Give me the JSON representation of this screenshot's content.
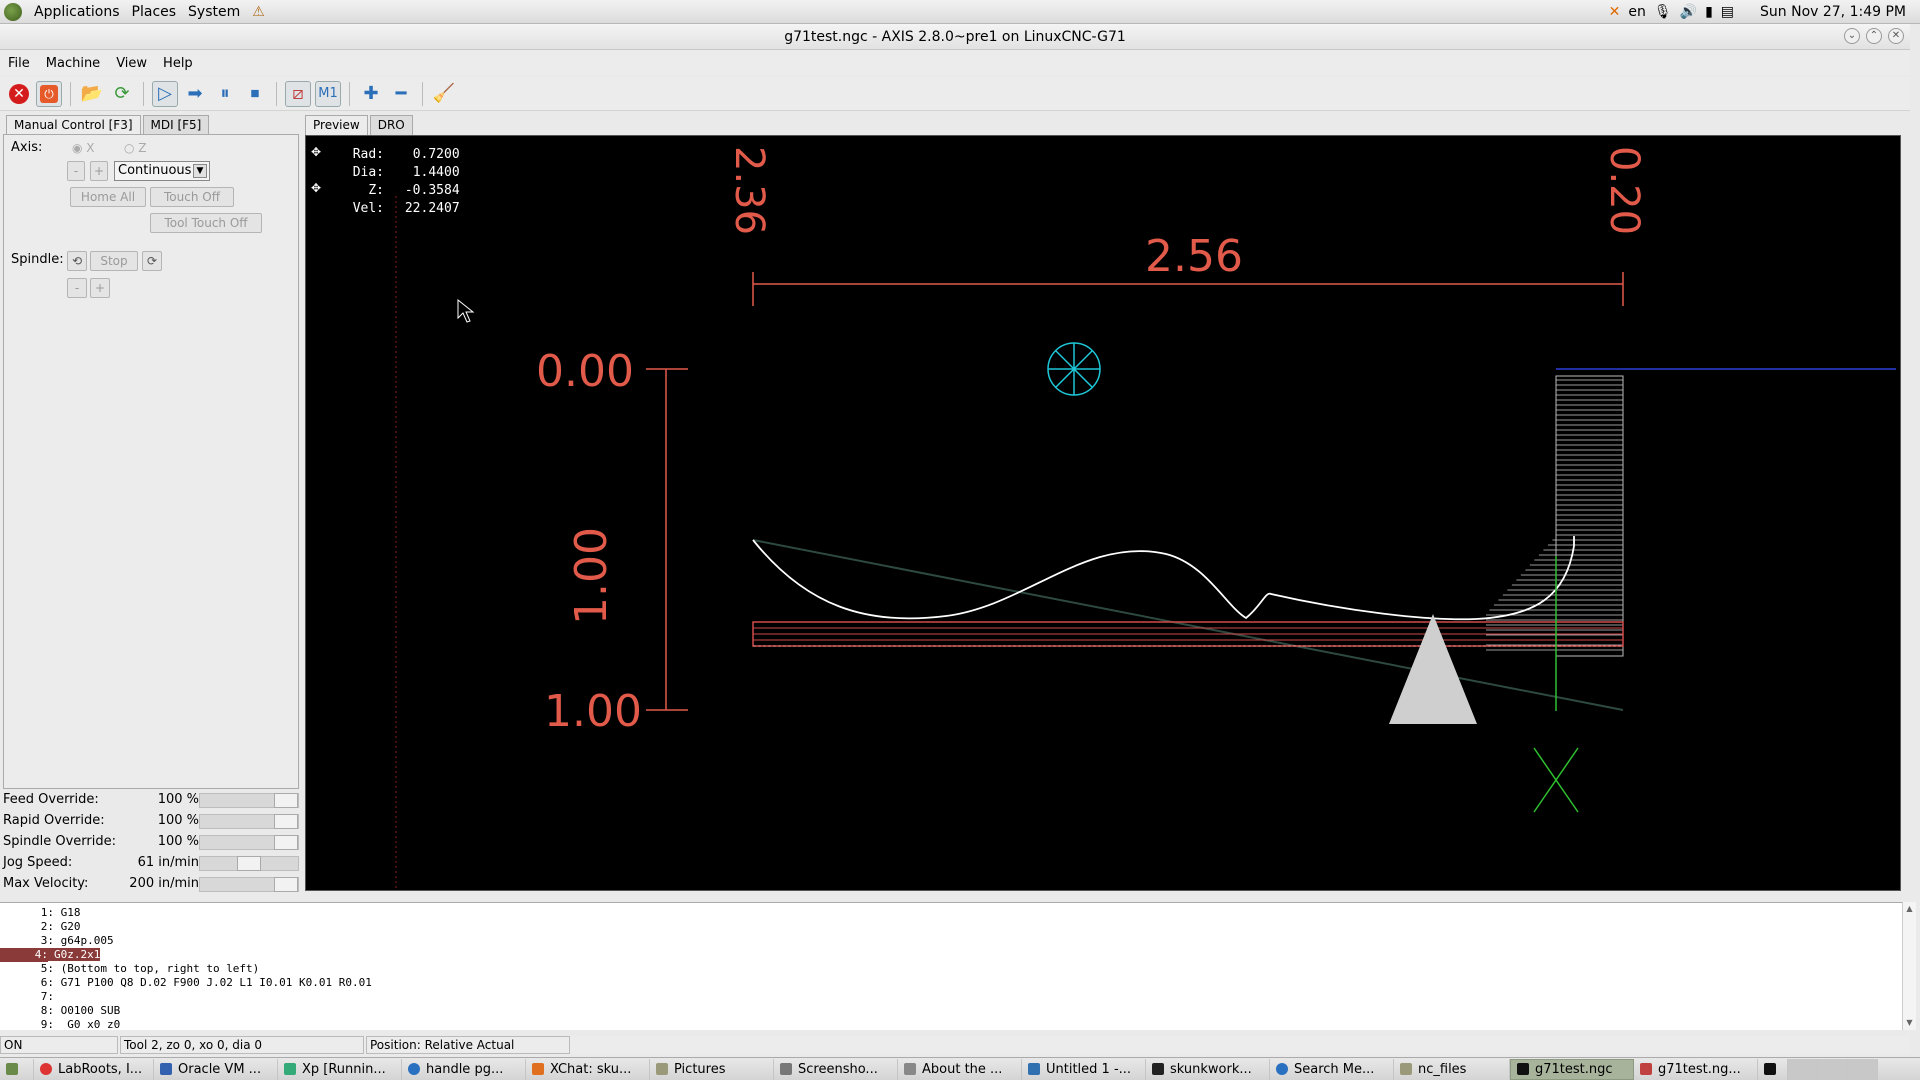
{
  "panel": {
    "menus": [
      "Applications",
      "Places",
      "System"
    ],
    "tray": {
      "lang": "en",
      "clock": "Sun Nov 27,  1:49 PM"
    }
  },
  "window": {
    "title": "g71test.ngc - AXIS 2.8.0~pre1 on LinuxCNC-G71"
  },
  "menubar": {
    "items": [
      "File",
      "Machine",
      "View",
      "Help"
    ]
  },
  "tabs": {
    "manual": "Manual Control [F3]",
    "mdi": "MDI [F5]",
    "preview": "Preview",
    "dro": "DRO"
  },
  "manual": {
    "axis_label": "Axis:",
    "axis_x": "X",
    "axis_z": "Z",
    "minus": "-",
    "plus": "+",
    "jog_mode": "Continuous",
    "home_all": "Home All",
    "touch_off": "Touch Off",
    "tool_touch_off": "Tool Touch Off",
    "spindle_label": "Spindle:",
    "spindle_stop": "Stop"
  },
  "overrides": [
    {
      "name": "Feed Override:",
      "value": "100 %",
      "level": 1.0
    },
    {
      "name": "Rapid Override:",
      "value": "100 %",
      "level": 1.0
    },
    {
      "name": "Spindle Override:",
      "value": "100 %",
      "level": 1.0
    },
    {
      "name": "Jog Speed:",
      "value": "61 in/min",
      "level": 0.5
    },
    {
      "name": "Max Velocity:",
      "value": "200 in/min",
      "level": 1.0
    }
  ],
  "dro": {
    "rad_label": "Rad:",
    "rad": "0.7200",
    "dia_label": "Dia:",
    "dia": "1.4400",
    "z_label": "Z:",
    "z": "-0.3584",
    "vel_label": "Vel:",
    "vel": "22.2407"
  },
  "preview_dims": {
    "top_width": "2.56",
    "left_top": "0.00",
    "left_mid": "1.00",
    "left_bottom": "1.00",
    "rot_left": "2.36",
    "rot_right": "0.20"
  },
  "gcode": [
    {
      "num": "1:",
      "text": "G18"
    },
    {
      "num": "2:",
      "text": "G20"
    },
    {
      "num": "3:",
      "text": "g64p.005"
    },
    {
      "num": "4:",
      "text": "G0z.2x1"
    },
    {
      "num": "5:",
      "text": "(Bottom to top, right to left)"
    },
    {
      "num": "6:",
      "text": "G71 P100 Q8 D.02 F900 J.02 L1 I0.01 K0.01 R0.01"
    },
    {
      "num": "7:",
      "text": ""
    },
    {
      "num": "8:",
      "text": "O0100 SUB"
    },
    {
      "num": "9:",
      "text": " G0 x0 z0"
    }
  ],
  "status": {
    "state": "ON",
    "tool": "Tool 2, zo 0, xo 0, dia 0",
    "position": "Position: Relative Actual"
  },
  "taskbar": [
    "LabRoots, I...",
    "Oracle VM ...",
    "Xp [Runnin...",
    "handle pg...",
    "XChat: sku...",
    "Pictures",
    "Screensho...",
    "About the ...",
    "Untitled 1 -...",
    "skunkwork...",
    "Search Me...",
    "nc_files",
    "g71test.ngc",
    "g71test.ng..."
  ],
  "colors": {
    "dim_red": "#e25a4a",
    "path_white": "#ffffff",
    "tool_cyan": "#1ec8d8",
    "origin_green": "#2ec02e"
  }
}
